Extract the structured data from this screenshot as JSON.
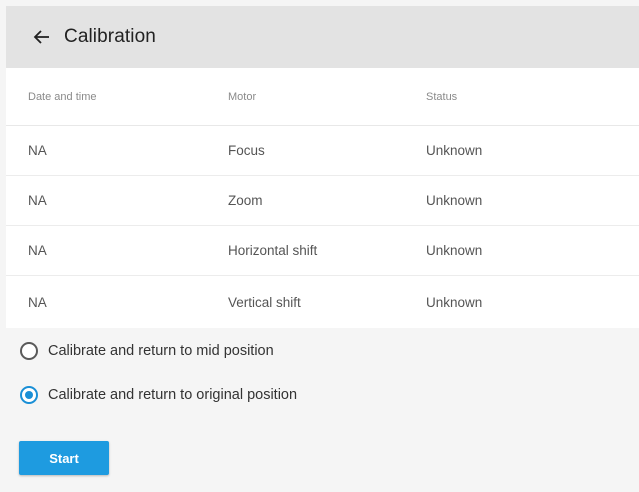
{
  "header": {
    "back_icon": "arrow-left-icon",
    "title": "Calibration"
  },
  "table": {
    "columns": [
      "Date and time",
      "Motor",
      "Status"
    ],
    "rows": [
      {
        "date": "NA",
        "motor": "Focus",
        "status": "Unknown"
      },
      {
        "date": "NA",
        "motor": "Zoom",
        "status": "Unknown"
      },
      {
        "date": "NA",
        "motor": "Horizontal shift",
        "status": "Unknown"
      },
      {
        "date": "NA",
        "motor": "Vertical shift",
        "status": "Unknown"
      }
    ]
  },
  "options": {
    "items": [
      {
        "label": "Calibrate and return to mid position",
        "selected": false
      },
      {
        "label": "Calibrate and return to original position",
        "selected": true
      }
    ],
    "accent_color": "#1a8fd6"
  },
  "actions": {
    "start_label": "Start",
    "button_color": "#1e9be0"
  }
}
